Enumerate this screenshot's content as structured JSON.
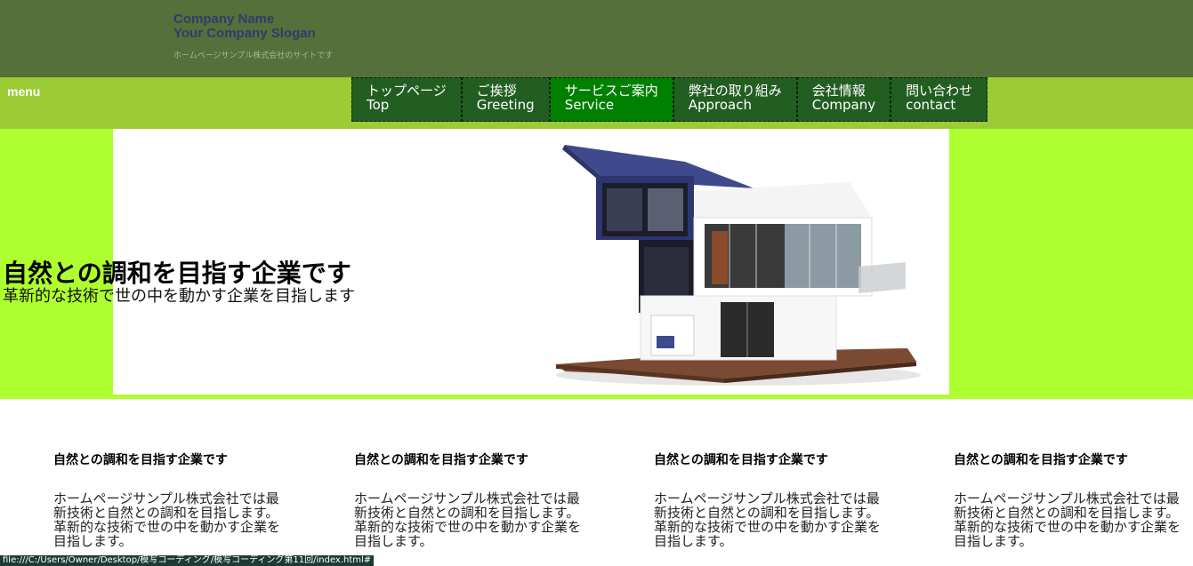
{
  "header": {
    "company_name": "Company Name",
    "company_slogan": "Your Company Slogan",
    "site_description": "ホームページサンプル株式会社のサイトです"
  },
  "menu": {
    "label": "menu",
    "items": [
      {
        "jp": "トップページ",
        "en": "Top",
        "active": false
      },
      {
        "jp": "ご挨拶",
        "en": "Greeting",
        "active": false
      },
      {
        "jp": "サービスご案内",
        "en": "Service",
        "active": true
      },
      {
        "jp": "弊社の取り組み",
        "en": "Approach",
        "active": false
      },
      {
        "jp": "会社情報",
        "en": "Company",
        "active": false
      },
      {
        "jp": "問い合わせ",
        "en": "contact",
        "active": false
      }
    ]
  },
  "hero": {
    "title": "自然との調和を目指す企業です",
    "subtitle": "革新的な技術で世の中を動かす企業を目指します",
    "image": "modern-house-image"
  },
  "features": [
    {
      "title": "自然との調和を目指す企業です",
      "text": "ホームページサンプル株式会社では最新技術と自然との調和を目指します。革新的な技術で世の中を動かす企業を目指します。"
    },
    {
      "title": "自然との調和を目指す企業です",
      "text": "ホームページサンプル株式会社では最新技術と自然との調和を目指します。革新的な技術で世の中を動かす企業を目指します。"
    },
    {
      "title": "自然との調和を目指す企業です",
      "text": "ホームページサンプル株式会社では最新技術と自然との調和を目指します。革新的な技術で世の中を動かす企業を目指します。"
    },
    {
      "title": "自然との調和を目指す企業です",
      "text": "ホームページサンプル株式会社では最新技術と自然との調和を目指します。革新的な技術で世の中を動かす企業を目指します。"
    }
  ],
  "status_bar": {
    "url": "file:///C:/Users/Owner/Desktop/模写コーディング/模写コーディング第11回/index.html#"
  },
  "colors": {
    "header_bg": "#55703b",
    "menubar_bg": "#9bcc35",
    "nav_bg": "#225e21",
    "nav_active_bg": "#008000",
    "hero_bg": "#adff2f"
  }
}
